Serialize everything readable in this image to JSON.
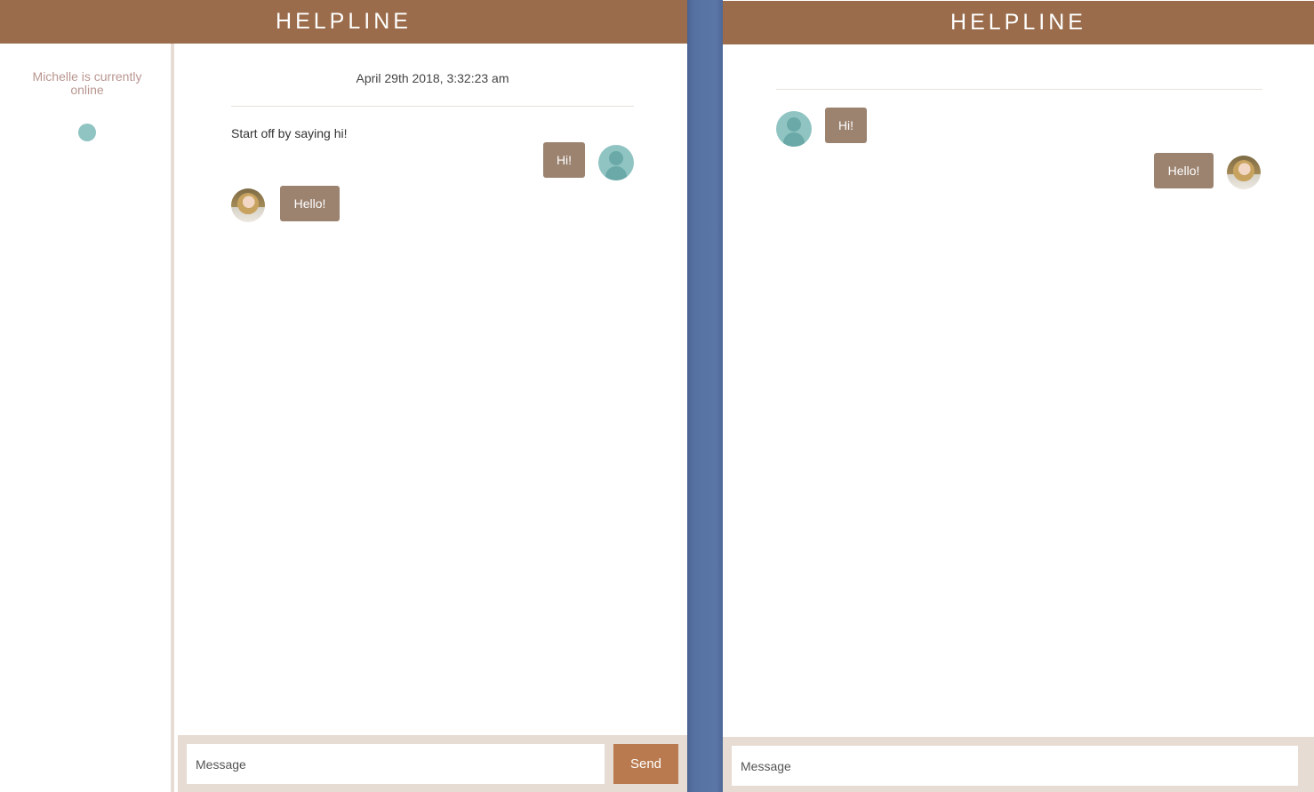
{
  "app": {
    "title": "HELPLINE"
  },
  "agent_window": {
    "header_title": "HELPLINE",
    "sidebar": {
      "status_text": "Michelle is currently online",
      "status": "online",
      "status_color": "#8fc4c2"
    },
    "chat": {
      "date": "April 29th 2018, 3:32:23 am",
      "hint": "Start off by saying hi!",
      "messages": [
        {
          "from": "user",
          "text": "Hi!"
        },
        {
          "from": "agent",
          "text": "Hello!"
        }
      ]
    },
    "composer": {
      "placeholder": "Message",
      "value": "",
      "send_label": "Send"
    }
  },
  "user_window": {
    "header_title": "HELPLINE",
    "chat": {
      "messages": [
        {
          "from": "user",
          "text": "Hi!"
        },
        {
          "from": "agent",
          "text": "Hello!"
        }
      ]
    },
    "composer": {
      "placeholder": "Message",
      "value": ""
    }
  },
  "colors": {
    "header": "#9a6c4b",
    "bubble": "#9c8370",
    "send_button": "#b87a4e",
    "composer_bg": "#e6dcd3",
    "desktop_bg": "#5672a2"
  }
}
